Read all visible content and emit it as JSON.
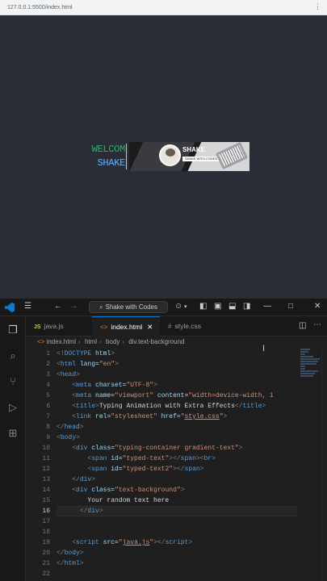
{
  "browser": {
    "url": "127.0.0.1:5500/index.html",
    "menu_icon": "more-vertical-icon"
  },
  "preview": {
    "typed_text": "WELCOM",
    "typed_text2": "SHAKE",
    "banner": {
      "brand": "SHAKE",
      "tagline": "SHAKE WITH CODES"
    }
  },
  "vscode": {
    "search": "Shake with Codes",
    "tabs": [
      {
        "label": "java.js",
        "icon": "js-icon"
      },
      {
        "label": "index.html",
        "icon": "html-icon"
      },
      {
        "label": "style.css",
        "icon": "css-icon"
      }
    ],
    "breadcrumb": [
      "index.html",
      "html",
      "body",
      "div.text-background"
    ],
    "line_numbers": [
      "1",
      "2",
      "3",
      "4",
      "5",
      "6",
      "7",
      "8",
      "9",
      "10",
      "11",
      "12",
      "13",
      "14",
      "15",
      "16",
      "17",
      "18",
      "19",
      "20",
      "21",
      "22"
    ],
    "current_line": 16,
    "code": [
      [
        {
          "c": "bracket",
          "t": "<"
        },
        {
          "c": "tag-c",
          "t": "!DOCTYPE"
        },
        {
          "c": "txt",
          "t": " "
        },
        {
          "c": "attr",
          "t": "html"
        },
        {
          "c": "bracket",
          "t": ">"
        }
      ],
      [
        {
          "c": "bracket",
          "t": "<"
        },
        {
          "c": "tag-c",
          "t": "html"
        },
        {
          "c": "txt",
          "t": " "
        },
        {
          "c": "attr",
          "t": "lang"
        },
        {
          "c": "txt",
          "t": "="
        },
        {
          "c": "val",
          "t": "\"en\""
        },
        {
          "c": "bracket",
          "t": ">"
        }
      ],
      [
        {
          "c": "bracket",
          "t": "<"
        },
        {
          "c": "tag-c",
          "t": "head"
        },
        {
          "c": "bracket",
          "t": ">"
        }
      ],
      [
        {
          "c": "txt",
          "t": "    "
        },
        {
          "c": "bracket",
          "t": "<"
        },
        {
          "c": "tag-c",
          "t": "meta"
        },
        {
          "c": "txt",
          "t": " "
        },
        {
          "c": "attr",
          "t": "charset"
        },
        {
          "c": "txt",
          "t": "="
        },
        {
          "c": "val",
          "t": "\"UTF-8\""
        },
        {
          "c": "bracket",
          "t": ">"
        }
      ],
      [
        {
          "c": "txt",
          "t": "    "
        },
        {
          "c": "bracket",
          "t": "<"
        },
        {
          "c": "tag-c",
          "t": "meta"
        },
        {
          "c": "txt",
          "t": " "
        },
        {
          "c": "attr",
          "t": "name"
        },
        {
          "c": "txt",
          "t": "="
        },
        {
          "c": "val",
          "t": "\"viewport\""
        },
        {
          "c": "txt",
          "t": " "
        },
        {
          "c": "attr",
          "t": "content"
        },
        {
          "c": "txt",
          "t": "="
        },
        {
          "c": "val",
          "t": "\"width=device-width, i"
        }
      ],
      [
        {
          "c": "txt",
          "t": "    "
        },
        {
          "c": "bracket",
          "t": "<"
        },
        {
          "c": "tag-c",
          "t": "title"
        },
        {
          "c": "bracket",
          "t": ">"
        },
        {
          "c": "txt",
          "t": "Typing Animation with Extra Effects"
        },
        {
          "c": "bracket",
          "t": "</"
        },
        {
          "c": "tag-c",
          "t": "title"
        },
        {
          "c": "bracket",
          "t": ">"
        }
      ],
      [
        {
          "c": "txt",
          "t": "    "
        },
        {
          "c": "bracket",
          "t": "<"
        },
        {
          "c": "tag-c",
          "t": "link"
        },
        {
          "c": "txt",
          "t": " "
        },
        {
          "c": "attr",
          "t": "rel"
        },
        {
          "c": "txt",
          "t": "="
        },
        {
          "c": "val",
          "t": "\"stylesheet\""
        },
        {
          "c": "txt",
          "t": " "
        },
        {
          "c": "attr",
          "t": "href"
        },
        {
          "c": "txt",
          "t": "="
        },
        {
          "c": "val",
          "t": "\""
        },
        {
          "c": "link",
          "t": "style.css"
        },
        {
          "c": "val",
          "t": "\""
        },
        {
          "c": "bracket",
          "t": ">"
        }
      ],
      [
        {
          "c": "bracket",
          "t": "</"
        },
        {
          "c": "tag-c",
          "t": "head"
        },
        {
          "c": "bracket",
          "t": ">"
        }
      ],
      [
        {
          "c": "bracket",
          "t": "<"
        },
        {
          "c": "tag-c",
          "t": "body"
        },
        {
          "c": "bracket",
          "t": ">"
        }
      ],
      [
        {
          "c": "txt",
          "t": "    "
        },
        {
          "c": "bracket",
          "t": "<"
        },
        {
          "c": "tag-c",
          "t": "div"
        },
        {
          "c": "txt",
          "t": " "
        },
        {
          "c": "attr",
          "t": "class"
        },
        {
          "c": "txt",
          "t": "="
        },
        {
          "c": "val",
          "t": "\"typing-container gradient-text\""
        },
        {
          "c": "bracket",
          "t": ">"
        }
      ],
      [
        {
          "c": "txt",
          "t": "        "
        },
        {
          "c": "bracket",
          "t": "<"
        },
        {
          "c": "tag-c",
          "t": "span"
        },
        {
          "c": "txt",
          "t": " "
        },
        {
          "c": "attr",
          "t": "id"
        },
        {
          "c": "txt",
          "t": "="
        },
        {
          "c": "val",
          "t": "\"typed-text\""
        },
        {
          "c": "bracket",
          "t": "></"
        },
        {
          "c": "tag-c",
          "t": "span"
        },
        {
          "c": "bracket",
          "t": "><"
        },
        {
          "c": "tag-c",
          "t": "br"
        },
        {
          "c": "bracket",
          "t": ">"
        }
      ],
      [
        {
          "c": "txt",
          "t": "        "
        },
        {
          "c": "bracket",
          "t": "<"
        },
        {
          "c": "tag-c",
          "t": "span"
        },
        {
          "c": "txt",
          "t": " "
        },
        {
          "c": "attr",
          "t": "id"
        },
        {
          "c": "txt",
          "t": "="
        },
        {
          "c": "val",
          "t": "\"typed-text2\""
        },
        {
          "c": "bracket",
          "t": "></"
        },
        {
          "c": "tag-c",
          "t": "span"
        },
        {
          "c": "bracket",
          "t": ">"
        }
      ],
      [
        {
          "c": "txt",
          "t": "    "
        },
        {
          "c": "bracket",
          "t": "</"
        },
        {
          "c": "tag-c",
          "t": "div"
        },
        {
          "c": "bracket",
          "t": ">"
        }
      ],
      [
        {
          "c": "txt",
          "t": "    "
        },
        {
          "c": "bracket",
          "t": "<"
        },
        {
          "c": "tag-c",
          "t": "div"
        },
        {
          "c": "txt",
          "t": " "
        },
        {
          "c": "attr",
          "t": "class"
        },
        {
          "c": "txt",
          "t": "="
        },
        {
          "c": "val",
          "t": "\"text-background\""
        },
        {
          "c": "bracket",
          "t": ">"
        }
      ],
      [
        {
          "c": "txt",
          "t": "        Your random text here"
        }
      ],
      [
        {
          "c": "txt",
          "t": "      "
        },
        {
          "c": "bracket",
          "t": "</"
        },
        {
          "c": "tag-c",
          "t": "div"
        },
        {
          "c": "bracket",
          "t": ">"
        }
      ],
      [],
      [],
      [
        {
          "c": "txt",
          "t": "    "
        },
        {
          "c": "bracket",
          "t": "<"
        },
        {
          "c": "tag-c",
          "t": "script"
        },
        {
          "c": "txt",
          "t": " "
        },
        {
          "c": "attr",
          "t": "src"
        },
        {
          "c": "txt",
          "t": "="
        },
        {
          "c": "val",
          "t": "\""
        },
        {
          "c": "link",
          "t": "java.js"
        },
        {
          "c": "val",
          "t": "\""
        },
        {
          "c": "bracket",
          "t": "></"
        },
        {
          "c": "tag-c",
          "t": "script"
        },
        {
          "c": "bracket",
          "t": ">"
        }
      ],
      [
        {
          "c": "bracket",
          "t": "</"
        },
        {
          "c": "tag-c",
          "t": "body"
        },
        {
          "c": "bracket",
          "t": ">"
        }
      ],
      [
        {
          "c": "bracket",
          "t": "</"
        },
        {
          "c": "tag-c",
          "t": "html"
        },
        {
          "c": "bracket",
          "t": ">"
        }
      ],
      []
    ]
  }
}
